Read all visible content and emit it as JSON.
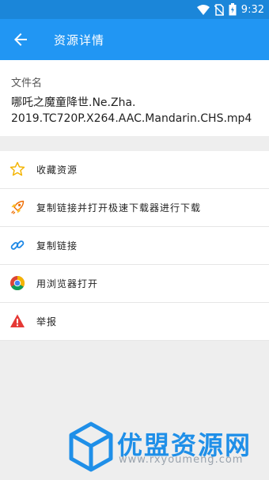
{
  "status_bar": {
    "time": "9:32"
  },
  "app_bar": {
    "title": "资源详情"
  },
  "file": {
    "label": "文件名",
    "name": "哪吒之魔童降世.Ne.Zha.\n2019.TC720P.X264.AAC.Mandarin.CHS.mp4"
  },
  "menu": {
    "items": [
      {
        "label": "收藏资源",
        "icon": "star-icon"
      },
      {
        "label": "复制链接并打开极速下载器进行下载",
        "icon": "rocket-icon"
      },
      {
        "label": "复制链接",
        "icon": "link-icon"
      },
      {
        "label": "用浏览器打开",
        "icon": "chrome-icon"
      },
      {
        "label": "举报",
        "icon": "warning-icon"
      }
    ]
  },
  "watermark": {
    "brand": "优盟资源网",
    "url": "www.rxyoumeng.com"
  },
  "colors": {
    "primary": "#2196f3",
    "status_bar": "#1b86d9",
    "brand": "#1f8fe8"
  }
}
